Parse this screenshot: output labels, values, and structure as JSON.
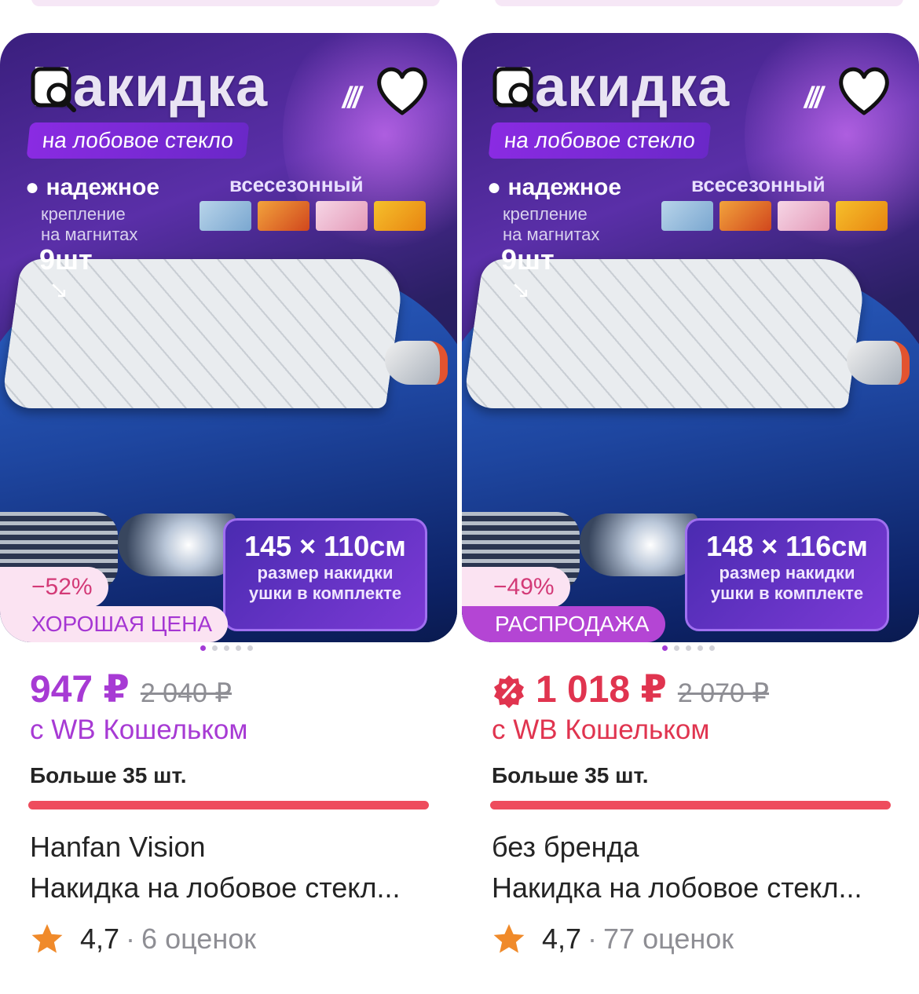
{
  "colors": {
    "accent_purple": "#a73ad4",
    "accent_red": "#e0344f",
    "stock_bar": "#ee4c5d",
    "muted_text": "#8e8e94",
    "star": "#f08a2a"
  },
  "products": [
    {
      "image": {
        "title": "Накидка",
        "subtitle": "на лобовое стекло",
        "feature_title": "надежное",
        "feature_line1": "крепление",
        "feature_line2": "на магнитах",
        "feature_count": "9шт",
        "season_label": "всесезонный",
        "size_dim": "145 × 110см",
        "size_caption1": "размер накидки",
        "size_caption2": "ушки в комплекте"
      },
      "icons": {
        "search": "search-photo-icon",
        "favorite": "heart-icon"
      },
      "discount": "−52%",
      "label": "ХОРОШАЯ ЦЕНА",
      "price": "947 ₽",
      "old_price": "2 040 ₽",
      "wallet_note": "с WB Кошельком",
      "stock": "Больше 35 шт.",
      "brand": "Hanfan Vision",
      "name": "Накидка на лобовое стекл...",
      "rating": "4,7",
      "separator": "·",
      "reviews": "6 оценок"
    },
    {
      "image": {
        "title": "Накидка",
        "subtitle": "на лобовое стекло",
        "feature_title": "надежное",
        "feature_line1": "крепление",
        "feature_line2": "на магнитах",
        "feature_count": "9шт",
        "season_label": "всесезонный",
        "size_dim": "148 × 116см",
        "size_caption1": "размер накидки",
        "size_caption2": "ушки в комплекте"
      },
      "icons": {
        "search": "search-photo-icon",
        "favorite": "heart-icon",
        "promo": "percent-badge-icon"
      },
      "discount": "−49%",
      "label": "РАСПРОДАЖА",
      "price": "1 018 ₽",
      "old_price": "2 070 ₽",
      "wallet_note": "с WB Кошельком",
      "stock": "Больше 35 шт.",
      "brand": "без бренда",
      "name": "Накидка на лобовое стекл...",
      "rating": "4,7",
      "separator": "·",
      "reviews": "77 оценок"
    }
  ]
}
